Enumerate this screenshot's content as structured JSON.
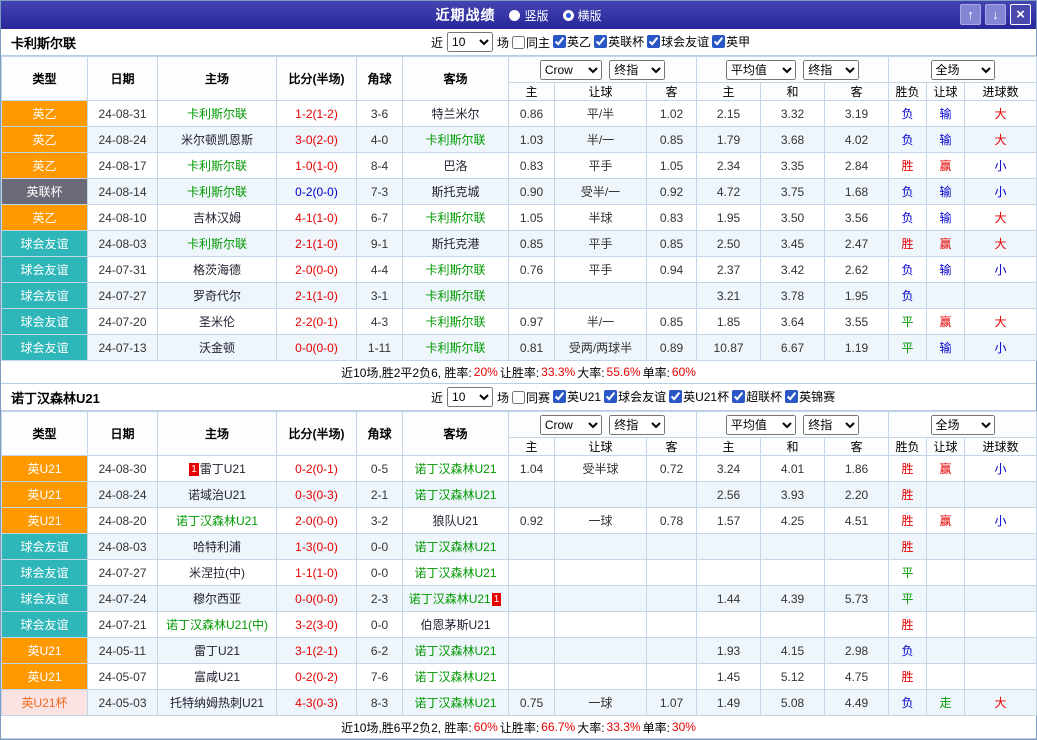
{
  "header": {
    "title": "近期战绩",
    "layout_options": {
      "vertical": "竖版",
      "horizontal": "横版",
      "selected": "横版"
    },
    "buttons": {
      "up": "↑",
      "down": "↓",
      "close": "×"
    }
  },
  "table_headers": {
    "columns": {
      "type": "类型",
      "date": "日期",
      "home": "主场",
      "score": "比分(半场)",
      "corner": "角球",
      "away": "客场",
      "odds_home": "主",
      "odds_line": "让球",
      "odds_away": "客",
      "avg_home": "主",
      "avg_draw": "和",
      "avg_away": "客",
      "wdl": "胜负",
      "handicap": "让球",
      "goals": "进球数"
    },
    "dropdowns": {
      "company": "Crow",
      "final": "终指",
      "average": "平均值",
      "scope": "全场"
    }
  },
  "sections": [
    {
      "team": "卡利斯尔联",
      "filter": {
        "near": "近",
        "count": "10",
        "unit": "场",
        "same": "同主",
        "leagues": [
          "英乙",
          "英联杯",
          "球会友谊",
          "英甲"
        ]
      },
      "rows": [
        {
          "type": "英乙",
          "type_style": "t-orange",
          "date": "24-08-31",
          "home": "卡利斯尔联",
          "home_focus": true,
          "score": "1-2(1-2)",
          "score_color": "red",
          "corner": "3-6",
          "away": "特兰米尔",
          "odds_home": "0.86",
          "odds_line": "平/半",
          "odds_away": "1.02",
          "avg_home": "2.15",
          "avg_draw": "3.32",
          "avg_away": "3.19",
          "result": "负",
          "result_color": "blue",
          "handicap": "输",
          "handicap_color": "blue",
          "goals": "大",
          "goals_color": "red"
        },
        {
          "type": "英乙",
          "type_style": "t-orange",
          "date": "24-08-24",
          "home": "米尔顿凯恩斯",
          "score": "3-0(2-0)",
          "score_color": "red",
          "corner": "4-0",
          "away": "卡利斯尔联",
          "away_focus": true,
          "odds_home": "1.03",
          "odds_line": "半/一",
          "odds_away": "0.85",
          "avg_home": "1.79",
          "avg_draw": "3.68",
          "avg_away": "4.02",
          "result": "负",
          "result_color": "blue",
          "handicap": "输",
          "handicap_color": "blue",
          "goals": "大",
          "goals_color": "red"
        },
        {
          "type": "英乙",
          "type_style": "t-orange",
          "date": "24-08-17",
          "home": "卡利斯尔联",
          "home_focus": true,
          "score": "1-0(1-0)",
          "score_color": "red",
          "corner": "8-4",
          "away": "巴洛",
          "odds_home": "0.83",
          "odds_line": "平手",
          "odds_away": "1.05",
          "avg_home": "2.34",
          "avg_draw": "3.35",
          "avg_away": "2.84",
          "result": "胜",
          "result_color": "red",
          "handicap": "赢",
          "handicap_color": "red",
          "goals": "小",
          "goals_color": "blue"
        },
        {
          "type": "英联杯",
          "type_style": "t-gray",
          "date": "24-08-14",
          "home": "卡利斯尔联",
          "home_focus": true,
          "score": "0-2(0-0)",
          "score_color": "blue",
          "corner": "7-3",
          "away": "斯托克城",
          "odds_home": "0.90",
          "odds_line": "受半/一",
          "odds_away": "0.92",
          "avg_home": "4.72",
          "avg_draw": "3.75",
          "avg_away": "1.68",
          "result": "负",
          "result_color": "blue",
          "handicap": "输",
          "handicap_color": "blue",
          "goals": "小",
          "goals_color": "blue"
        },
        {
          "type": "英乙",
          "type_style": "t-orange",
          "date": "24-08-10",
          "home": "吉林汉姆",
          "score": "4-1(1-0)",
          "score_color": "red",
          "corner": "6-7",
          "away": "卡利斯尔联",
          "away_focus": true,
          "odds_home": "1.05",
          "odds_line": "半球",
          "odds_away": "0.83",
          "avg_home": "1.95",
          "avg_draw": "3.50",
          "avg_away": "3.56",
          "result": "负",
          "result_color": "blue",
          "handicap": "输",
          "handicap_color": "blue",
          "goals": "大",
          "goals_color": "red"
        },
        {
          "type": "球会友谊",
          "type_style": "t-teal",
          "date": "24-08-03",
          "home": "卡利斯尔联",
          "home_focus": true,
          "score": "2-1(1-0)",
          "score_color": "red",
          "corner": "9-1",
          "away": "斯托克港",
          "odds_home": "0.85",
          "odds_line": "平手",
          "odds_away": "0.85",
          "avg_home": "2.50",
          "avg_draw": "3.45",
          "avg_away": "2.47",
          "result": "胜",
          "result_color": "red",
          "handicap": "赢",
          "handicap_color": "red",
          "goals": "大",
          "goals_color": "red"
        },
        {
          "type": "球会友谊",
          "type_style": "t-teal",
          "date": "24-07-31",
          "home": "格茨海德",
          "score": "2-0(0-0)",
          "score_color": "red",
          "corner": "4-4",
          "away": "卡利斯尔联",
          "away_focus": true,
          "odds_home": "0.76",
          "odds_line": "平手",
          "odds_away": "0.94",
          "avg_home": "2.37",
          "avg_draw": "3.42",
          "avg_away": "2.62",
          "result": "负",
          "result_color": "blue",
          "handicap": "输",
          "handicap_color": "blue",
          "goals": "小",
          "goals_color": "blue"
        },
        {
          "type": "球会友谊",
          "type_style": "t-teal",
          "date": "24-07-27",
          "home": "罗奇代尔",
          "score": "2-1(1-0)",
          "score_color": "red",
          "corner": "3-1",
          "away": "卡利斯尔联",
          "away_focus": true,
          "avg_home": "3.21",
          "avg_draw": "3.78",
          "avg_away": "1.95",
          "result": "负",
          "result_color": "blue"
        },
        {
          "type": "球会友谊",
          "type_style": "t-teal",
          "date": "24-07-20",
          "home": "圣米伦",
          "score": "2-2(0-1)",
          "score_color": "red",
          "corner": "4-3",
          "away": "卡利斯尔联",
          "away_focus": true,
          "odds_home": "0.97",
          "odds_line": "半/一",
          "odds_away": "0.85",
          "avg_home": "1.85",
          "avg_draw": "3.64",
          "avg_away": "3.55",
          "result": "平",
          "result_color": "green",
          "handicap": "赢",
          "handicap_color": "red",
          "goals": "大",
          "goals_color": "red"
        },
        {
          "type": "球会友谊",
          "type_style": "t-teal",
          "date": "24-07-13",
          "home": "沃金顿",
          "score": "0-0(0-0)",
          "score_color": "red",
          "corner": "1-11",
          "away": "卡利斯尔联",
          "away_focus": true,
          "odds_home": "0.81",
          "odds_line": "受两/两球半",
          "odds_away": "0.89",
          "avg_home": "10.87",
          "avg_draw": "6.67",
          "avg_away": "1.19",
          "result": "平",
          "result_color": "green",
          "handicap": "输",
          "handicap_color": "blue",
          "goals": "小",
          "goals_color": "blue"
        }
      ],
      "summary": [
        {
          "t": "近10场,胜2平2负6, 胜率:",
          "red": false
        },
        {
          "t": "20%",
          "red": true
        },
        {
          "t": " 让胜率:",
          "red": false
        },
        {
          "t": "33.3%",
          "red": true
        },
        {
          "t": " 大率:",
          "red": false
        },
        {
          "t": "55.6%",
          "red": true
        },
        {
          "t": " 单率:",
          "red": false
        },
        {
          "t": "60%",
          "red": true
        }
      ]
    },
    {
      "team": "诺丁汉森林U21",
      "filter": {
        "near": "近",
        "count": "10",
        "unit": "场",
        "same": "同赛",
        "leagues": [
          "英U21",
          "球会友谊",
          "英U21杯",
          "超联杯",
          "英锦赛"
        ]
      },
      "rows": [
        {
          "type": "英U21",
          "type_style": "t-orange",
          "date": "24-08-30",
          "home": "雷丁U21",
          "home_badge": "1",
          "score": "0-2(0-1)",
          "score_color": "red",
          "corner": "0-5",
          "away": "诺丁汉森林U21",
          "away_focus": true,
          "odds_home": "1.04",
          "odds_line": "受半球",
          "odds_away": "0.72",
          "avg_home": "3.24",
          "avg_draw": "4.01",
          "avg_away": "1.86",
          "result": "胜",
          "result_color": "red",
          "handicap": "赢",
          "handicap_color": "red",
          "goals": "小",
          "goals_color": "blue"
        },
        {
          "type": "英U21",
          "type_style": "t-orange",
          "date": "24-08-24",
          "home": "诺域治U21",
          "score": "0-3(0-3)",
          "score_color": "red",
          "corner": "2-1",
          "away": "诺丁汉森林U21",
          "away_focus": true,
          "avg_home": "2.56",
          "avg_draw": "3.93",
          "avg_away": "2.20",
          "result": "胜",
          "result_color": "red"
        },
        {
          "type": "英U21",
          "type_style": "t-orange",
          "date": "24-08-20",
          "home": "诺丁汉森林U21",
          "home_focus": true,
          "score": "2-0(0-0)",
          "score_color": "red",
          "corner": "3-2",
          "away": "狼队U21",
          "odds_home": "0.92",
          "odds_line": "一球",
          "odds_away": "0.78",
          "avg_home": "1.57",
          "avg_draw": "4.25",
          "avg_away": "4.51",
          "result": "胜",
          "result_color": "red",
          "handicap": "赢",
          "handicap_color": "red",
          "goals": "小",
          "goals_color": "blue"
        },
        {
          "type": "球会友谊",
          "type_style": "t-teal",
          "date": "24-08-03",
          "home": "哈特利浦",
          "score": "1-3(0-0)",
          "score_color": "red",
          "corner": "0-0",
          "away": "诺丁汉森林U21",
          "away_focus": true,
          "result": "胜",
          "result_color": "red"
        },
        {
          "type": "球会友谊",
          "type_style": "t-teal",
          "date": "24-07-27",
          "home": "米涅拉(中)",
          "score": "1-1(1-0)",
          "score_color": "red",
          "corner": "0-0",
          "away": "诺丁汉森林U21",
          "away_focus": true,
          "result": "平",
          "result_color": "green"
        },
        {
          "type": "球会友谊",
          "type_style": "t-teal",
          "date": "24-07-24",
          "home": "穆尔西亚",
          "score": "0-0(0-0)",
          "score_color": "red",
          "corner": "2-3",
          "away": "诺丁汉森林U21",
          "away_focus": true,
          "away_badge": "1",
          "avg_home": "1.44",
          "avg_draw": "4.39",
          "avg_away": "5.73",
          "result": "平",
          "result_color": "green"
        },
        {
          "type": "球会友谊",
          "type_style": "t-teal",
          "date": "24-07-21",
          "home": "诺丁汉森林U21(中)",
          "home_focus": true,
          "score": "3-2(3-0)",
          "score_color": "red",
          "corner": "0-0",
          "away": "伯恩茅斯U21",
          "result": "胜",
          "result_color": "red"
        },
        {
          "type": "英U21",
          "type_style": "t-orange",
          "date": "24-05-11",
          "home": "雷丁U21",
          "score": "3-1(2-1)",
          "score_color": "red",
          "corner": "6-2",
          "away": "诺丁汉森林U21",
          "away_focus": true,
          "avg_home": "1.93",
          "avg_draw": "4.15",
          "avg_away": "2.98",
          "result": "负",
          "result_color": "blue"
        },
        {
          "type": "英U21",
          "type_style": "t-orange",
          "date": "24-05-07",
          "home": "富咸U21",
          "score": "0-2(0-2)",
          "score_color": "red",
          "corner": "7-6",
          "away": "诺丁汉森林U21",
          "away_focus": true,
          "avg_home": "1.45",
          "avg_draw": "5.12",
          "avg_away": "4.75",
          "result": "胜",
          "result_color": "red"
        },
        {
          "type": "英U21杯",
          "type_style": "t-pink",
          "date": "24-05-03",
          "home": "托特纳姆热刺U21",
          "score": "4-3(0-3)",
          "score_color": "red",
          "corner": "8-3",
          "away": "诺丁汉森林U21",
          "away_focus": true,
          "odds_home": "0.75",
          "odds_line": "一球",
          "odds_away": "1.07",
          "avg_home": "1.49",
          "avg_draw": "5.08",
          "avg_away": "4.49",
          "result": "负",
          "result_color": "blue",
          "handicap": "走",
          "handicap_color": "green",
          "goals": "大",
          "goals_color": "red"
        }
      ],
      "summary": [
        {
          "t": "近10场,胜6平2负2, 胜率:",
          "red": false
        },
        {
          "t": "60%",
          "red": true
        },
        {
          "t": " 让胜率:",
          "red": false
        },
        {
          "t": "66.7%",
          "red": true
        },
        {
          "t": " 大率:",
          "red": false
        },
        {
          "t": "33.3%",
          "red": true
        },
        {
          "t": " 单率:",
          "red": false
        },
        {
          "t": "30%",
          "red": true
        }
      ]
    }
  ]
}
